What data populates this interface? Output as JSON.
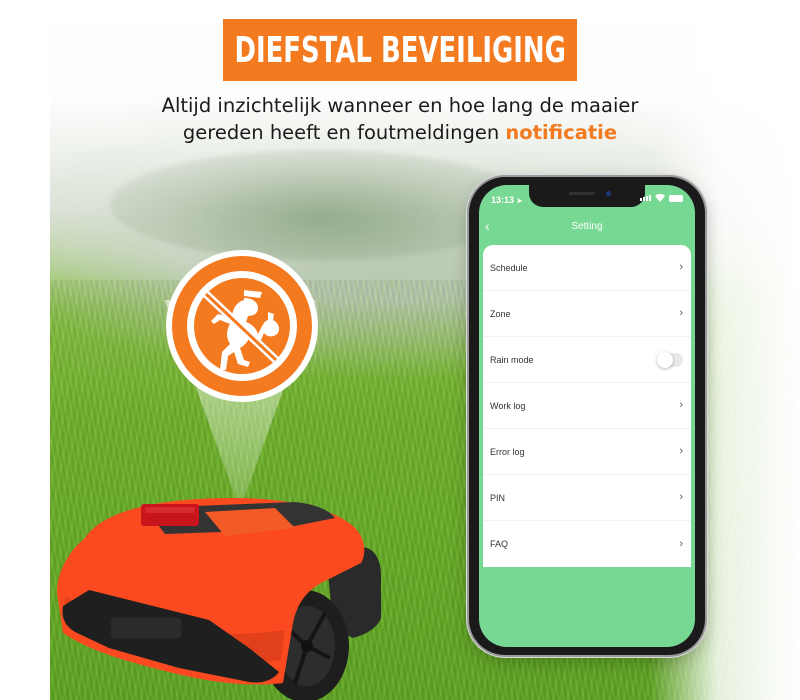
{
  "banner": {
    "title": "DIEFSTAL BEVEILIGING",
    "subtitle_line1": "Altijd inzichtelijk wanneer en hoe lang de maaier",
    "subtitle_line2_prefix": "gereden heeft en foutmeldingen ",
    "subtitle_line2_accent": "notificatie"
  },
  "colors": {
    "brand_orange": "#f47a20",
    "app_green": "#77d893",
    "mower_orange": "#fb4a20"
  },
  "sign": {
    "icon": "no-thief-icon"
  },
  "phone": {
    "status_time": "13:13",
    "location_icon": "➤",
    "nav_back_icon": "‹",
    "screen_title": "Setting",
    "settings": [
      {
        "label": "Schedule",
        "control": "chevron",
        "icon": "›"
      },
      {
        "label": "Zone",
        "control": "chevron",
        "icon": "›"
      },
      {
        "label": "Rain mode",
        "control": "toggle",
        "on": false
      },
      {
        "label": "Work log",
        "control": "chevron",
        "icon": "›"
      },
      {
        "label": "Error log",
        "control": "chevron",
        "icon": "›"
      },
      {
        "label": "PIN",
        "control": "chevron",
        "icon": "›"
      },
      {
        "label": "FAQ",
        "control": "chevron",
        "icon": "›"
      }
    ]
  }
}
